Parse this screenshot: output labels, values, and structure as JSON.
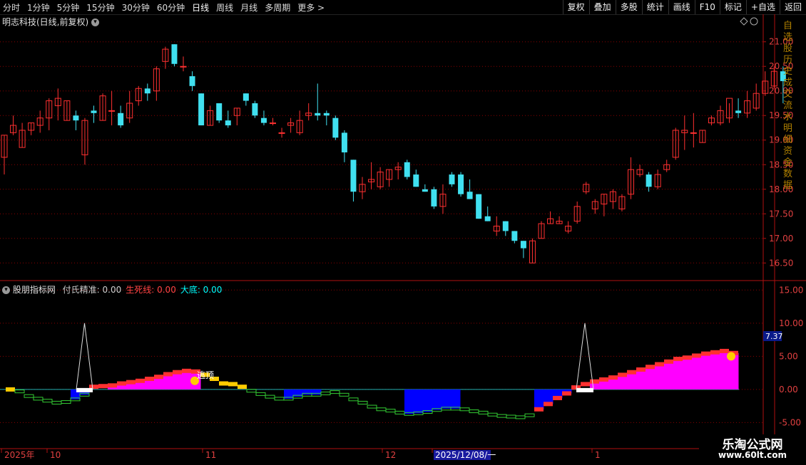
{
  "toolbar": {
    "periods": [
      "分时",
      "1分钟",
      "5分钟",
      "15分钟",
      "30分钟",
      "60分钟",
      "日线",
      "周线",
      "月线",
      "多周期",
      "更多 >"
    ],
    "active_period": "日线",
    "actions": [
      "复权",
      "叠加",
      "多股",
      "统计",
      "画线",
      "F10",
      "标记",
      "+自选",
      "返回"
    ]
  },
  "main_pane": {
    "title": "明志科技(日线,前复权)",
    "y_ticks": [
      "21.00",
      "20.50",
      "20.00",
      "19.50",
      "19.00",
      "18.50",
      "18.00",
      "17.50",
      "17.00",
      "16.50"
    ]
  },
  "indicator_pane": {
    "name": "股朋指标网",
    "items": [
      {
        "label": "付氏精准:",
        "value": "0.00",
        "color": "#d0d0d0"
      },
      {
        "label": "生死线:",
        "value": "0.00",
        "color": "#ff4444"
      },
      {
        "label": "大底:",
        "value": "0.00",
        "color": "#00ffff"
      }
    ],
    "y_ticks": [
      "15.00",
      "10.00",
      "5.00",
      "0.00",
      "-5.00"
    ],
    "value_tag": "7.37",
    "annotation": "逃顶"
  },
  "date_axis": {
    "labels": [
      "2025年",
      "10",
      "11",
      "12",
      "2025/12/08/一",
      "1"
    ]
  },
  "side_strip_text": "自选股历史成交流水明细资金数据",
  "watermark": {
    "line1": "乐淘公式网",
    "line2": "www.60lt.com"
  },
  "colors": {
    "up": "#ff3030",
    "down": "#40e0f0",
    "grid": "#8b0000",
    "axis": "#b01010",
    "magenta": "#ff00ff",
    "blue": "#0000ff",
    "green": "#33cc33"
  },
  "chart_data": {
    "type": "candlestick",
    "ohlc": [
      [
        18.65,
        19.1,
        18.3,
        19.1
      ],
      [
        19.15,
        19.3,
        19.1,
        19.5
      ],
      [
        18.85,
        19.2,
        18.85,
        19.35
      ],
      [
        19.2,
        19.35,
        19.1,
        19.35
      ],
      [
        19.3,
        19.45,
        19.15,
        19.6
      ],
      [
        19.45,
        19.8,
        19.2,
        19.85
      ],
      [
        19.7,
        19.85,
        19.4,
        20.05
      ],
      [
        19.4,
        19.8,
        19.4,
        19.8
      ],
      [
        19.5,
        19.4,
        19.2,
        19.6
      ],
      [
        18.7,
        19.4,
        18.5,
        19.45
      ],
      [
        19.6,
        19.55,
        19.35,
        19.7
      ],
      [
        19.4,
        19.9,
        19.4,
        19.95
      ],
      [
        19.6,
        19.6,
        19.3,
        20.0
      ],
      [
        19.55,
        19.3,
        19.25,
        19.7
      ],
      [
        19.45,
        19.75,
        19.35,
        20.0
      ],
      [
        19.8,
        20.05,
        19.7,
        20.1
      ],
      [
        20.05,
        19.95,
        19.8,
        20.15
      ],
      [
        20.0,
        20.45,
        19.8,
        20.5
      ],
      [
        20.6,
        20.85,
        20.45,
        20.9
      ],
      [
        20.95,
        20.55,
        20.5,
        20.95
      ],
      [
        20.5,
        20.5,
        20.4,
        20.7
      ],
      [
        20.3,
        20.1,
        20.0,
        20.4
      ],
      [
        19.95,
        19.3,
        19.3,
        19.95
      ],
      [
        19.3,
        19.6,
        19.3,
        19.7
      ],
      [
        19.75,
        19.4,
        19.35,
        19.75
      ],
      [
        19.4,
        19.3,
        19.25,
        19.6
      ],
      [
        19.5,
        19.65,
        19.3,
        19.65
      ],
      [
        19.95,
        19.8,
        19.7,
        19.95
      ],
      [
        19.75,
        19.5,
        19.45,
        19.8
      ],
      [
        19.45,
        19.35,
        19.3,
        19.6
      ],
      [
        19.35,
        19.35,
        19.3,
        19.45
      ],
      [
        19.15,
        19.15,
        19.05,
        19.25
      ],
      [
        19.3,
        19.35,
        19.15,
        19.45
      ],
      [
        19.15,
        19.4,
        19.1,
        19.6
      ],
      [
        19.5,
        19.55,
        19.4,
        19.75
      ],
      [
        19.55,
        19.5,
        19.4,
        20.15
      ],
      [
        19.55,
        19.5,
        19.3,
        19.6
      ],
      [
        19.45,
        19.05,
        19.0,
        19.5
      ],
      [
        19.15,
        18.75,
        18.55,
        19.2
      ],
      [
        18.6,
        17.95,
        17.75,
        18.6
      ],
      [
        17.95,
        18.1,
        17.8,
        18.25
      ],
      [
        18.15,
        18.2,
        18.0,
        18.55
      ],
      [
        18.05,
        18.35,
        18.0,
        18.45
      ],
      [
        18.2,
        18.4,
        18.05,
        18.4
      ],
      [
        18.4,
        18.45,
        18.2,
        18.55
      ],
      [
        18.55,
        18.25,
        18.2,
        18.6
      ],
      [
        18.3,
        18.05,
        18.05,
        18.4
      ],
      [
        18.0,
        17.95,
        17.95,
        18.1
      ],
      [
        18.0,
        17.65,
        17.6,
        18.05
      ],
      [
        17.65,
        17.9,
        17.5,
        18.1
      ],
      [
        18.3,
        18.1,
        18.05,
        18.35
      ],
      [
        18.3,
        17.9,
        17.85,
        18.35
      ],
      [
        17.95,
        17.8,
        17.8,
        18.2
      ],
      [
        17.9,
        17.4,
        17.4,
        17.9
      ],
      [
        17.45,
        17.35,
        17.35,
        17.65
      ],
      [
        17.15,
        17.25,
        17.05,
        17.45
      ],
      [
        17.35,
        17.15,
        17.05,
        17.35
      ],
      [
        17.15,
        16.95,
        16.9,
        17.15
      ],
      [
        16.95,
        16.8,
        16.6,
        16.95
      ],
      [
        16.5,
        16.95,
        16.5,
        17.0
      ],
      [
        17.0,
        17.3,
        17.0,
        17.35
      ],
      [
        17.3,
        17.4,
        17.3,
        17.55
      ],
      [
        17.3,
        17.35,
        17.3,
        17.45
      ],
      [
        17.15,
        17.25,
        17.1,
        17.35
      ],
      [
        17.35,
        17.65,
        17.3,
        17.75
      ],
      [
        17.95,
        18.1,
        17.9,
        18.15
      ],
      [
        17.6,
        17.75,
        17.5,
        17.8
      ],
      [
        17.7,
        17.9,
        17.45,
        17.9
      ],
      [
        17.75,
        17.95,
        17.6,
        18.0
      ],
      [
        17.6,
        17.85,
        17.55,
        17.9
      ],
      [
        17.9,
        18.4,
        17.8,
        18.65
      ],
      [
        18.3,
        18.4,
        18.25,
        18.5
      ],
      [
        18.3,
        18.05,
        17.95,
        18.35
      ],
      [
        18.05,
        18.3,
        18.0,
        18.4
      ],
      [
        18.4,
        18.5,
        18.35,
        18.6
      ],
      [
        18.65,
        19.2,
        18.6,
        19.25
      ],
      [
        19.15,
        19.2,
        18.8,
        19.5
      ],
      [
        19.15,
        19.15,
        18.85,
        19.55
      ],
      [
        18.95,
        19.2,
        18.95,
        19.2
      ],
      [
        19.35,
        19.45,
        19.3,
        19.5
      ],
      [
        19.35,
        19.6,
        19.3,
        19.7
      ],
      [
        19.45,
        19.85,
        19.35,
        19.75
      ],
      [
        19.6,
        19.55,
        19.45,
        19.85
      ],
      [
        19.55,
        19.8,
        19.45,
        20.0
      ],
      [
        19.65,
        19.95,
        19.6,
        20.15
      ],
      [
        19.95,
        20.2,
        19.9,
        20.4
      ],
      [
        20.1,
        20.4,
        20.05,
        20.5
      ],
      [
        20.4,
        20.2,
        19.75,
        20.5
      ]
    ],
    "indicator_line": [
      0.0,
      -0.3,
      -1.0,
      -1.4,
      -1.7,
      -2.0,
      -1.9,
      -1.5,
      -0.8,
      0.4,
      0.5,
      0.6,
      0.9,
      1.1,
      1.3,
      1.6,
      1.9,
      2.3,
      2.6,
      2.8,
      2.7,
      2.2,
      1.6,
      0.9,
      0.8,
      0.4,
      -0.2,
      -0.7,
      -1.1,
      -1.4,
      -1.4,
      -1.1,
      -0.8,
      -0.8,
      -0.6,
      -0.4,
      -0.8,
      -1.5,
      -2.0,
      -2.6,
      -3.0,
      -3.2,
      -3.5,
      -3.7,
      -3.6,
      -3.4,
      -3.1,
      -2.9,
      -2.9,
      -3.0,
      -3.3,
      -3.5,
      -3.8,
      -4.0,
      -4.1,
      -4.2,
      -3.9,
      -3.0,
      -2.2,
      -1.3,
      -0.6,
      0.3,
      0.8,
      1.2,
      1.5,
      1.8,
      2.2,
      2.6,
      3.0,
      3.4,
      3.8,
      4.2,
      4.6,
      4.8,
      5.1,
      5.4,
      5.6,
      5.8,
      5.5
    ],
    "spikes_value": 10.0,
    "y_range_main": [
      16.2,
      21.3
    ],
    "y_range_ind": [
      -7.0,
      16.0
    ]
  }
}
